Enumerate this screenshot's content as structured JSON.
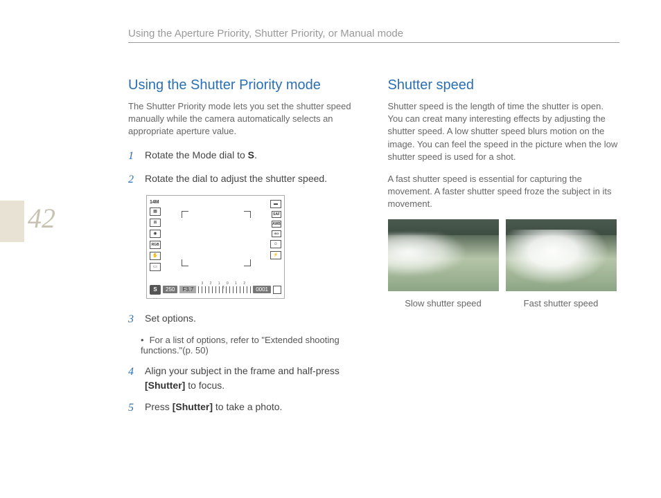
{
  "page_number": "42",
  "header": {
    "title": "Using the Aperture Priority, Shutter Priority, or Manual mode"
  },
  "left": {
    "heading": "Using the Shutter Priority mode",
    "intro": "The Shutter Priority mode lets you set the shutter speed manually while the camera automatically selects an appropriate aperture value.",
    "steps": [
      {
        "n": "1",
        "pre": "Rotate the Mode dial to ",
        "bold": "S",
        "post": "."
      },
      {
        "n": "2",
        "pre": "Rotate the dial to adjust the shutter speed.",
        "bold": "",
        "post": ""
      },
      {
        "n": "3",
        "pre": "Set options.",
        "bold": "",
        "post": ""
      },
      {
        "n": "4",
        "pre": "Align your subject in the frame and half-press ",
        "bold": "[Shutter]",
        "post": " to focus."
      },
      {
        "n": "5",
        "pre": "Press ",
        "bold": "[Shutter]",
        "post": " to take a photo."
      }
    ],
    "bullet": "For a list of options, refer to \"Extended shooting functions.\"(p. 50)",
    "lcd": {
      "size": "14M",
      "mode": "S",
      "shutter": "250",
      "aperture": "F3.7",
      "counter": "0001",
      "saf": "SAF",
      "awb": "AWB",
      "iso": "ISO AUTO"
    }
  },
  "right": {
    "heading": "Shutter speed",
    "para1": "Shutter speed is the length of time the shutter is open. You can creat many interesting effects by adjusting the shutter speed. A low shutter speed blurs motion on the image. You can feel the speed in the picture when the low shutter speed is used for a shot.",
    "para2": "A fast shutter speed is essential for capturing the movement. A faster shutter speed froze the subject in its movement.",
    "caption1": "Slow shutter speed",
    "caption2": "Fast shutter speed"
  }
}
